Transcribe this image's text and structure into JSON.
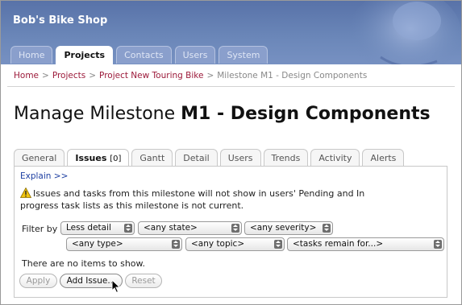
{
  "header": {
    "brand": "Bob's Bike Shop",
    "tabs": [
      {
        "label": "Home",
        "active": false
      },
      {
        "label": "Projects",
        "active": true
      },
      {
        "label": "Contacts",
        "active": false
      },
      {
        "label": "Users",
        "active": false
      },
      {
        "label": "System",
        "active": false
      }
    ]
  },
  "breadcrumb": {
    "items": [
      "Home",
      "Projects",
      "Project New Touring Bike"
    ],
    "current": "Milestone M1 - Design Components",
    "separator": ">"
  },
  "title": {
    "prefix": "Manage Milestone",
    "bold": "M1 - Design Components"
  },
  "section_tabs": [
    {
      "label": "General",
      "active": false
    },
    {
      "label": "Issues",
      "count": "[0]",
      "active": true
    },
    {
      "label": "Gantt",
      "active": false
    },
    {
      "label": "Detail",
      "active": false
    },
    {
      "label": "Users",
      "active": false
    },
    {
      "label": "Trends",
      "active": false
    },
    {
      "label": "Activity",
      "active": false
    },
    {
      "label": "Alerts",
      "active": false
    }
  ],
  "panel": {
    "explain_link": "Explain >>",
    "warning_line1": "Issues and tasks from this milestone will not show in users' Pending and In",
    "warning_line2": "progress task lists as this milestone is not current.",
    "filter_label": "Filter by",
    "filters": {
      "detail": "Less detail",
      "state": "<any state>",
      "severity": "<any severity>",
      "type": "<any type>",
      "topic": "<any topic>",
      "tasks": "<tasks remain for...>"
    },
    "empty_message": "There are no items to show.",
    "buttons": {
      "apply": "Apply",
      "add_issue": "Add Issue...",
      "reset": "Reset"
    }
  },
  "colors": {
    "header_bg": "#5872a8",
    "link": "#9c1a3a",
    "explain_link": "#1c3ea1"
  }
}
